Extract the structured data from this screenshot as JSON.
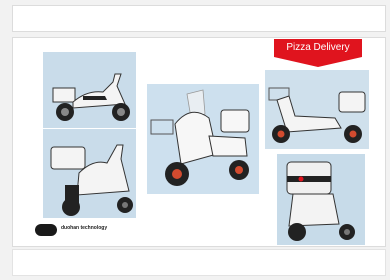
{
  "banner": {
    "label": "Pizza Delivery",
    "color": "#e0141e"
  },
  "brand": {
    "name": "duohan technology"
  },
  "photos": [
    {
      "name": "scooter-photo-side-left",
      "bg": "#c9dcea",
      "box": "#f4f4f4"
    },
    {
      "name": "scooter-photo-rear",
      "bg": "#c9dcea",
      "box": "#f4f4f4"
    },
    {
      "name": "scooter-photo-front",
      "bg": "#cde0ee",
      "box": "#f7f7f7"
    },
    {
      "name": "scooter-photo-side-right",
      "bg": "#cfe0ec",
      "box": "#f4f4f4"
    },
    {
      "name": "scooter-photo-pizza-box",
      "bg": "#c7dbe9",
      "box": "#f0f0f0"
    }
  ]
}
